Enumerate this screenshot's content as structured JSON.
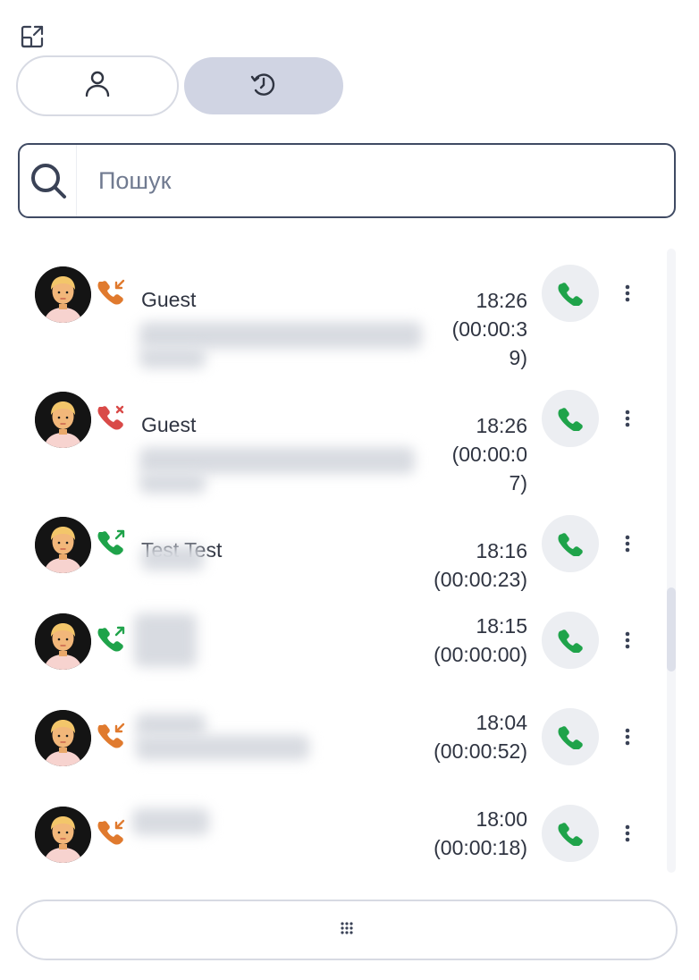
{
  "tabs": [
    {
      "id": "contacts",
      "icon": "person-icon",
      "active": false
    },
    {
      "id": "history",
      "icon": "history-icon",
      "active": true
    }
  ],
  "search": {
    "placeholder": "Пошук",
    "value": ""
  },
  "colors": {
    "incoming": "#e07a2e",
    "missed": "#d94a48",
    "outgoing": "#1fa34a",
    "call_green": "#1fa34a",
    "active_tab": "#d0d4e3"
  },
  "calls": [
    {
      "name": "Guest",
      "direction": "incoming",
      "time": "18:26",
      "duration_lines": [
        "(00:00:3",
        "9)"
      ]
    },
    {
      "name": "Guest",
      "direction": "missed",
      "time": "18:26",
      "duration_lines": [
        "(00:00:0",
        "7)"
      ]
    },
    {
      "name": "Test Test",
      "direction": "outgoing",
      "time": "18:16",
      "duration_lines": [
        "(00:00:23)"
      ]
    },
    {
      "name": "",
      "direction": "outgoing",
      "time": "18:15",
      "duration_lines": [
        "(00:00:00)"
      ]
    },
    {
      "name": "",
      "direction": "incoming",
      "time": "18:04",
      "duration_lines": [
        "(00:00:52)"
      ]
    },
    {
      "name": "",
      "direction": "incoming",
      "time": "18:00",
      "duration_lines": [
        "(00:00:18)"
      ]
    }
  ],
  "dialpad": {
    "icon": "dialpad-icon"
  }
}
